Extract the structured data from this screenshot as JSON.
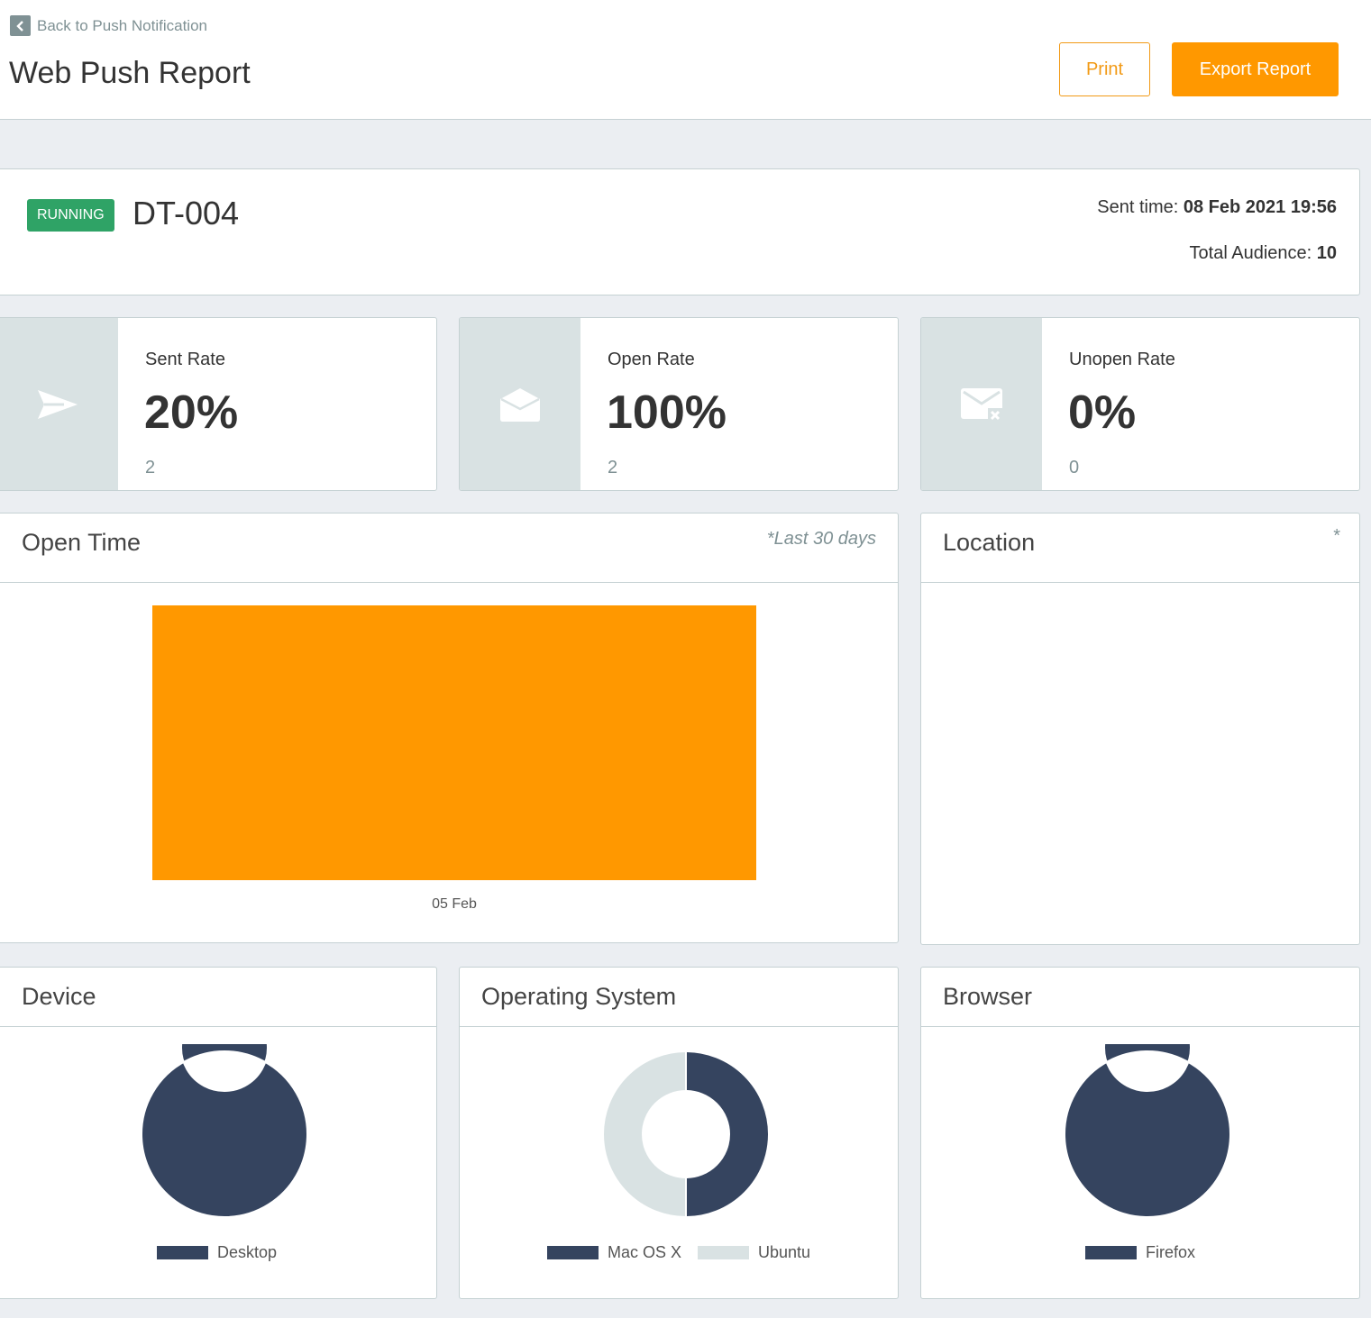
{
  "header": {
    "back_label": "Back to Push Notification",
    "title": "Web Push Report",
    "print_label": "Print",
    "export_label": "Export Report"
  },
  "summary": {
    "status": "RUNNING",
    "campaign": "DT-004",
    "sent_time_label": "Sent time: ",
    "sent_time_value": "08 Feb 2021 19:56",
    "audience_label": "Total Audience: ",
    "audience_value": "10"
  },
  "stats": [
    {
      "label": "Sent Rate",
      "value": "20%",
      "count": "2",
      "icon": "send-icon"
    },
    {
      "label": "Open Rate",
      "value": "100%",
      "count": "2",
      "icon": "envelope-open-icon"
    },
    {
      "label": "Unopen Rate",
      "value": "0%",
      "count": "0",
      "icon": "envelope-x-icon"
    }
  ],
  "panels": {
    "open_time": {
      "title": "Open Time",
      "note": "*Last 30 days"
    },
    "location": {
      "title": "Location",
      "note": "*"
    },
    "device": {
      "title": "Device"
    },
    "os": {
      "title": "Operating System"
    },
    "browser": {
      "title": "Browser"
    }
  },
  "colors": {
    "accent": "#ff9800",
    "running": "#2fa366",
    "series_dark": "#35445f",
    "series_light": "#d9e2e3"
  },
  "chart_data": [
    {
      "type": "bar",
      "title": "Open Time",
      "categories": [
        "05 Feb"
      ],
      "values": [
        1
      ],
      "ylim": [
        0,
        1
      ],
      "grid": false
    },
    {
      "type": "pie",
      "title": "Device",
      "labels": [
        "Desktop"
      ],
      "values": [
        1
      ],
      "colors": [
        "#35445f"
      ],
      "legend": "bottom"
    },
    {
      "type": "pie",
      "title": "Operating System",
      "labels": [
        "Mac OS X",
        "Ubuntu"
      ],
      "values": [
        1,
        1
      ],
      "colors": [
        "#35445f",
        "#d9e2e3"
      ],
      "legend": "bottom"
    },
    {
      "type": "pie",
      "title": "Browser",
      "labels": [
        "Firefox"
      ],
      "values": [
        1
      ],
      "colors": [
        "#35445f"
      ],
      "legend": "bottom"
    }
  ]
}
